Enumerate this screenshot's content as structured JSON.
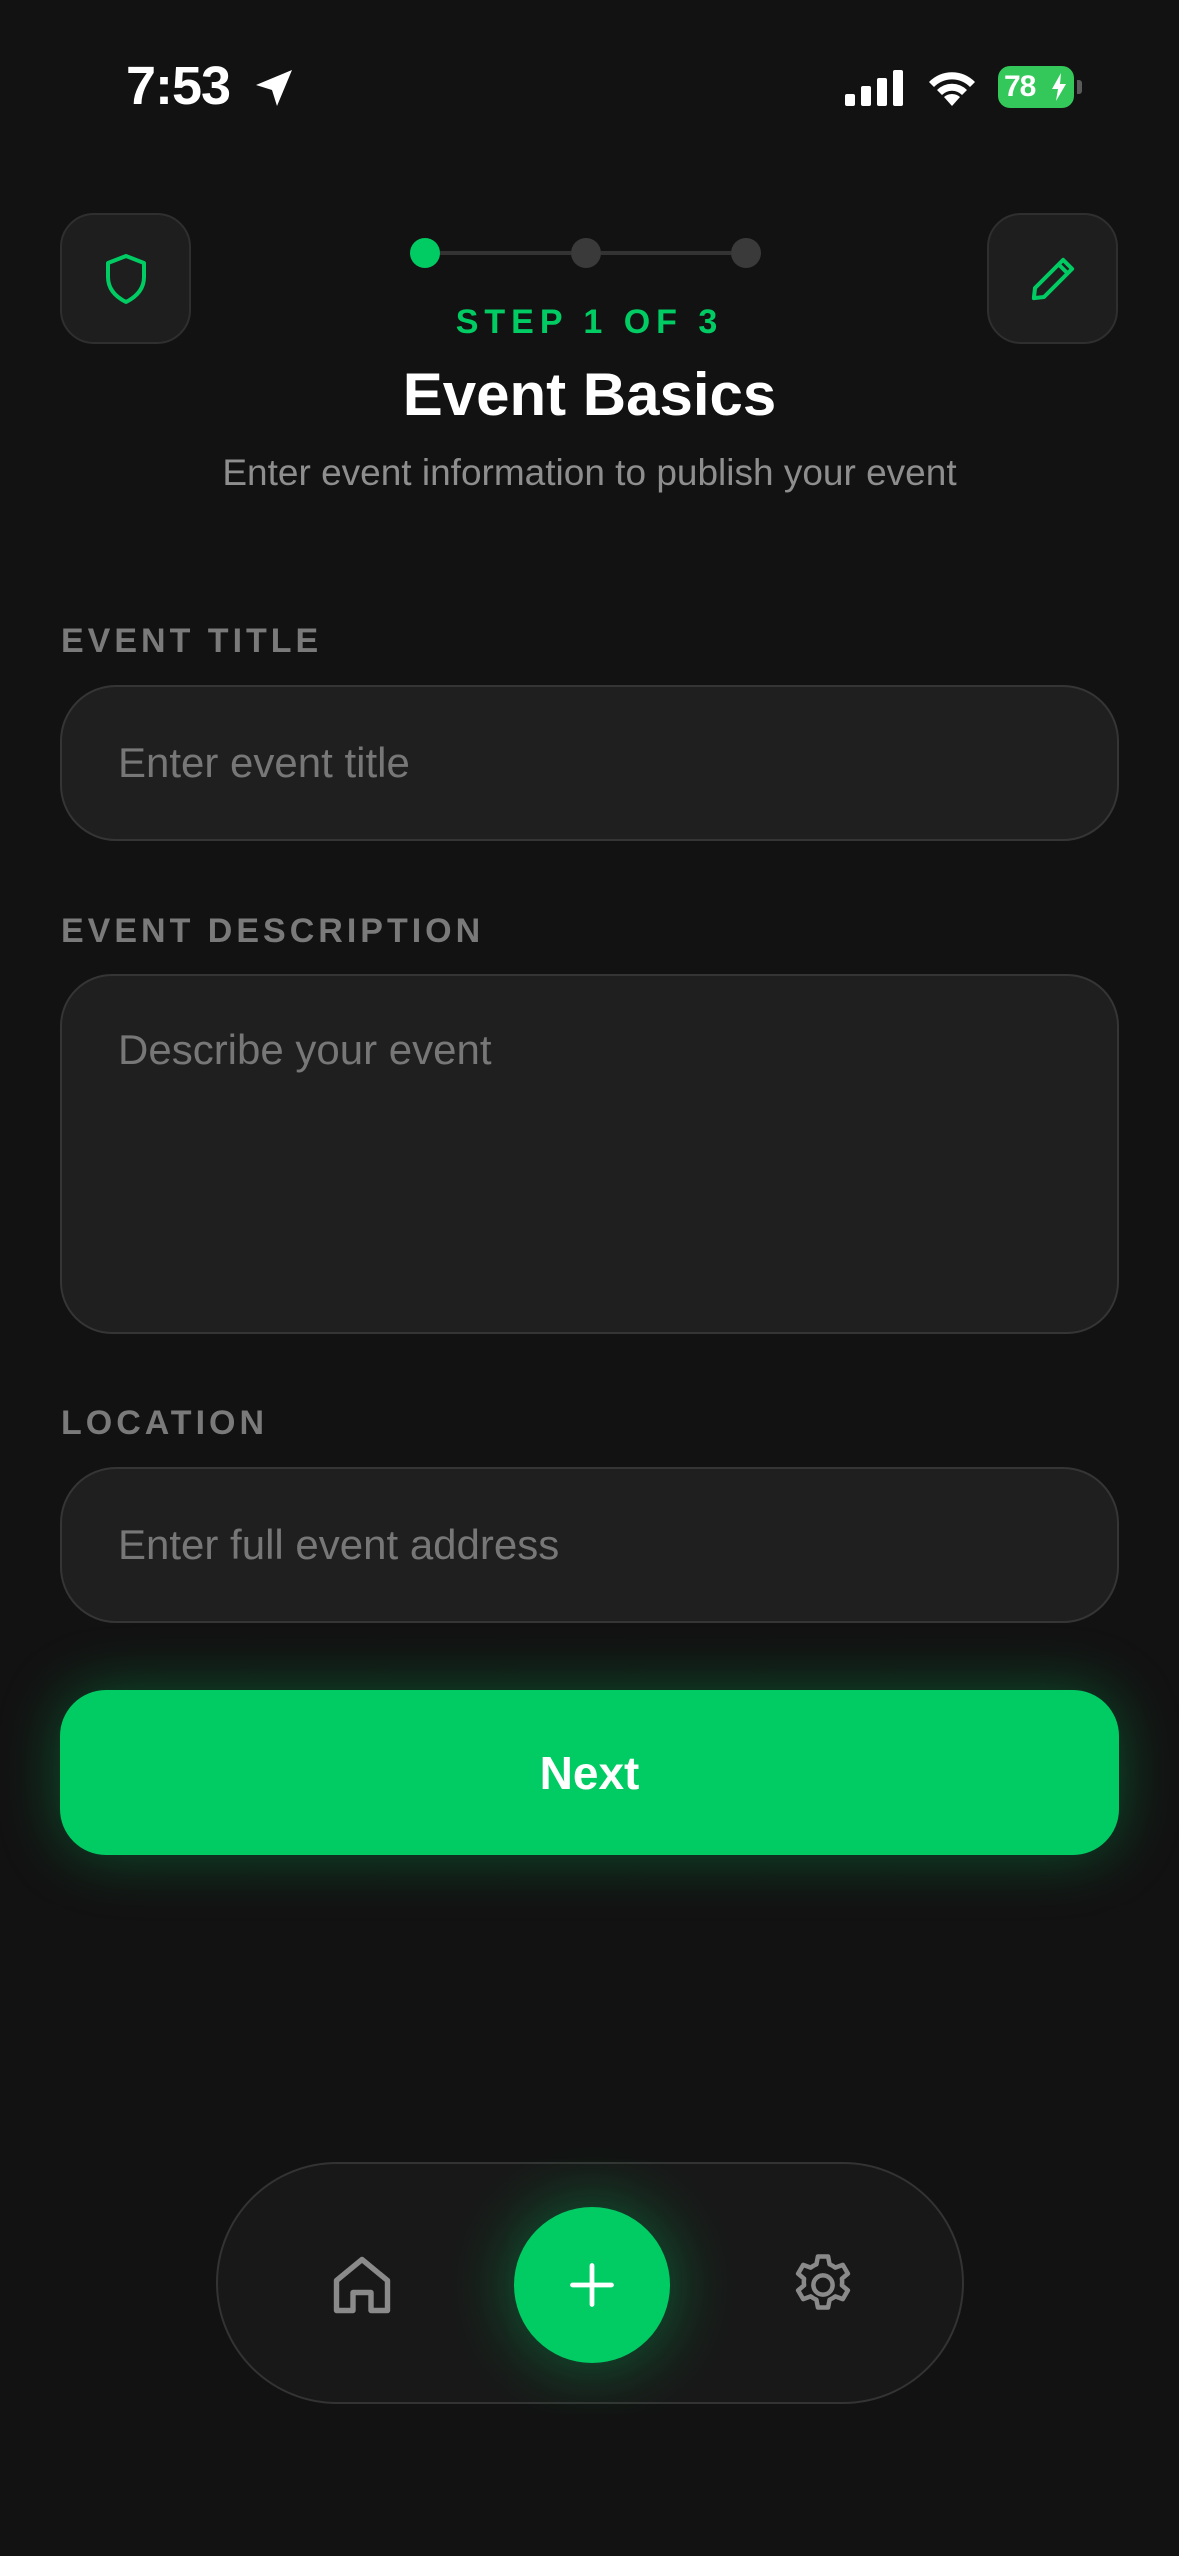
{
  "status_bar": {
    "time": "7:53",
    "battery_level": "78",
    "icons": [
      "location-arrow-icon",
      "signal-icon",
      "wifi-icon",
      "battery-charging-icon"
    ]
  },
  "header": {
    "left_icon": "shield-icon",
    "right_icon": "pencil-icon",
    "step_label": "STEP 1 OF 3",
    "title": "Event Basics",
    "subtitle": "Enter event information to publish your event",
    "steps_total": 3,
    "current_step": 1
  },
  "form": {
    "title": {
      "label": "EVENT TITLE",
      "placeholder": "Enter event title",
      "value": ""
    },
    "description": {
      "label": "EVENT DESCRIPTION",
      "placeholder": "Describe your event",
      "value": ""
    },
    "location": {
      "label": "LOCATION",
      "placeholder": "Enter full event address",
      "value": ""
    },
    "next_label": "Next"
  },
  "bottom_nav": {
    "items": [
      {
        "icon": "home-icon"
      },
      {
        "icon": "plus-icon"
      },
      {
        "icon": "gear-icon"
      }
    ]
  },
  "colors": {
    "background": "#121212",
    "accent": "#00cc63",
    "surface": "#1f1f1f",
    "muted_text": "#7a7a7a",
    "battery": "#34c759"
  }
}
